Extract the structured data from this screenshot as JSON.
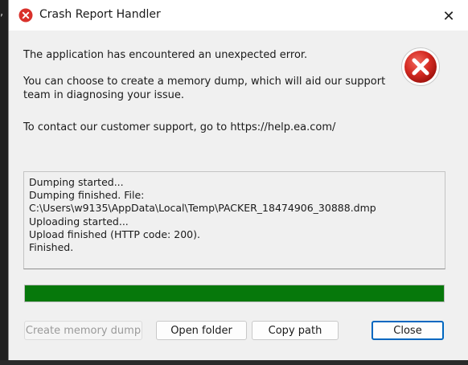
{
  "background": {
    "edge_glyph": ","
  },
  "window": {
    "title": "Crash Report Handler",
    "title_icon": "error-circle-icon",
    "close_icon": "close-icon",
    "close_glyph": "✕"
  },
  "message": {
    "line1": "The application has encountered an unexpected error.",
    "line2a": "You can choose to create a memory dump, which will aid our support",
    "line2b": "team in diagnosing your issue.",
    "line3": "To contact our customer support, go to https://help.ea.com/",
    "icon": "error-icon"
  },
  "log": [
    "Dumping started...",
    "Dumping finished. File:",
    "C:\\Users\\w9135\\AppData\\Local\\Temp\\PACKER_18474906_30888.dmp",
    "Uploading started...",
    "Upload finished (HTTP code: 200).",
    "Finished."
  ],
  "progress": {
    "value_percent": 100,
    "color": "#06780b"
  },
  "buttons": {
    "create_dump": "Create memory dump",
    "open_folder": "Open folder",
    "copy_path": "Copy path",
    "close": "Close"
  },
  "colors": {
    "error_red": "#d9312b",
    "accent": "#0067c0"
  }
}
